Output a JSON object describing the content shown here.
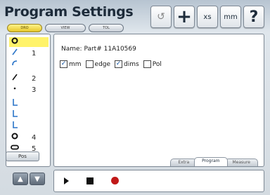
{
  "window": {
    "title": "Program Settings"
  },
  "mode_buttons": [
    {
      "label": "DRO",
      "active": true
    },
    {
      "label": "VIEW",
      "active": false
    },
    {
      "label": "TOL",
      "active": false
    }
  ],
  "toolbar": {
    "undo_icon": "undo-icon",
    "plus_icon": "plus-icon",
    "xs_label": "xs",
    "mm_label": "mm",
    "help_label": "?"
  },
  "sidebar": {
    "items": [
      {
        "icon": "circle-icon",
        "num": ""
      },
      {
        "icon": "line-icon",
        "num": "1"
      },
      {
        "icon": "arc-icon",
        "num": ""
      },
      {
        "icon": "line-icon",
        "num": "2"
      },
      {
        "icon": "point-icon",
        "num": "3"
      },
      {
        "icon": "angle-icon",
        "num": ""
      },
      {
        "icon": "angle-icon",
        "num": ""
      },
      {
        "icon": "angle-icon",
        "num": ""
      },
      {
        "icon": "circle-icon",
        "num": "4"
      },
      {
        "icon": "slot-icon",
        "num": "5"
      }
    ],
    "pos_label": "Pos"
  },
  "program": {
    "name_label": "Name: Part# 11A10569",
    "options": [
      {
        "label": "mm",
        "checked": true
      },
      {
        "label": "edge",
        "checked": false
      },
      {
        "label": "dims",
        "checked": true
      },
      {
        "label": "Pol",
        "checked": false
      }
    ]
  },
  "tabs": [
    {
      "label": "Extra",
      "active": false
    },
    {
      "label": "Program",
      "active": true
    },
    {
      "label": "Measure",
      "active": false
    }
  ],
  "colors": {
    "accent": "#fff36a",
    "record": "#c01818"
  }
}
